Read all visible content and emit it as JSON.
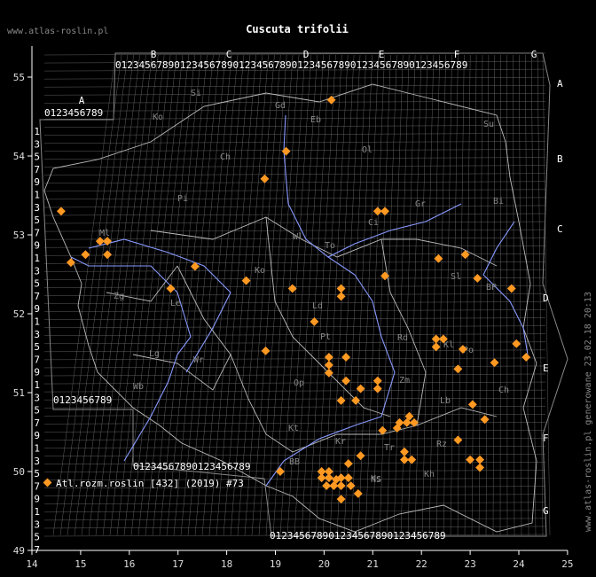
{
  "title": "Cuscuta trifolii",
  "site": "www.atlas-roslin.pl",
  "side_note": "www.atlas-roslin.pl generowane 23.02.18 20:13",
  "legend": {
    "label": "Atl.rozm.roslin [432] (2019) #73",
    "color": "#ff9922"
  },
  "colors": {
    "background": "#000000",
    "grid": "#888888",
    "river": "#8899ff",
    "border": "#bbbbbb",
    "point": "#ff9922",
    "axes": "#ffffff"
  },
  "axes": {
    "x_ticks": [
      "14",
      "15",
      "16",
      "17",
      "18",
      "19",
      "20",
      "21",
      "22",
      "23",
      "24",
      "25"
    ],
    "y_ticks": [
      "49",
      "50",
      "51",
      "52",
      "53",
      "54",
      "55"
    ]
  },
  "grid_letters_top": [
    "A",
    "B",
    "C",
    "D",
    "E",
    "F",
    "G"
  ],
  "grid_letters_right": [
    "A",
    "B",
    "C",
    "D",
    "E",
    "F",
    "G"
  ],
  "grid_digits": "0123456789",
  "region_labels": [
    "Si",
    "Gd",
    "Eb",
    "Ko",
    "Ol",
    "Ch",
    "Su",
    "Bi",
    "Pi",
    "Ci",
    "Gr",
    "Wl",
    "To",
    "Ml",
    "Ko",
    "Sl",
    "BP",
    "Zg",
    "Le",
    "Po",
    "Ld",
    "Pt",
    "Rd",
    "Lb",
    "Ch",
    "Lg",
    "Wr",
    "Op",
    "Kt",
    "Kr",
    "Ks",
    "Tr",
    "Rz",
    "Kh",
    "Zm",
    "BB",
    "NS",
    "Kl",
    "Wb"
  ],
  "points_lonlat": [
    [
      20.15,
      54.71
    ],
    [
      19.22,
      54.06
    ],
    [
      18.78,
      53.71
    ],
    [
      21.1,
      53.3
    ],
    [
      21.25,
      53.3
    ],
    [
      14.6,
      53.3
    ],
    [
      15.4,
      52.92
    ],
    [
      15.55,
      52.92
    ],
    [
      15.1,
      52.75
    ],
    [
      15.55,
      52.75
    ],
    [
      14.8,
      52.65
    ],
    [
      17.35,
      52.6
    ],
    [
      22.35,
      52.7
    ],
    [
      22.9,
      52.75
    ],
    [
      21.25,
      52.48
    ],
    [
      18.4,
      52.42
    ],
    [
      23.15,
      52.45
    ],
    [
      16.85,
      52.32
    ],
    [
      19.35,
      52.32
    ],
    [
      20.35,
      52.32
    ],
    [
      20.35,
      52.22
    ],
    [
      23.85,
      52.32
    ],
    [
      19.8,
      51.9
    ],
    [
      22.3,
      51.68
    ],
    [
      22.45,
      51.68
    ],
    [
      22.3,
      51.58
    ],
    [
      22.85,
      51.55
    ],
    [
      23.95,
      51.62
    ],
    [
      18.8,
      51.53
    ],
    [
      20.1,
      51.45
    ],
    [
      20.45,
      51.45
    ],
    [
      24.15,
      51.45
    ],
    [
      23.5,
      51.38
    ],
    [
      20.1,
      51.35
    ],
    [
      20.1,
      51.25
    ],
    [
      22.75,
      51.3
    ],
    [
      20.45,
      51.15
    ],
    [
      21.1,
      51.15
    ],
    [
      21.1,
      51.05
    ],
    [
      20.75,
      51.05
    ],
    [
      20.35,
      50.9
    ],
    [
      20.65,
      50.9
    ],
    [
      23.05,
      50.85
    ],
    [
      21.75,
      50.7
    ],
    [
      21.55,
      50.62
    ],
    [
      21.7,
      50.62
    ],
    [
      21.85,
      50.62
    ],
    [
      21.5,
      50.55
    ],
    [
      21.2,
      50.52
    ],
    [
      23.3,
      50.66
    ],
    [
      22.75,
      50.4
    ],
    [
      21.65,
      50.25
    ],
    [
      21.65,
      50.15
    ],
    [
      21.8,
      50.15
    ],
    [
      20.75,
      50.2
    ],
    [
      23.0,
      50.15
    ],
    [
      23.2,
      50.15
    ],
    [
      23.2,
      50.05
    ],
    [
      20.5,
      50.1
    ],
    [
      19.1,
      50.0
    ],
    [
      19.95,
      50.0
    ],
    [
      20.1,
      50.0
    ],
    [
      20.25,
      49.9
    ],
    [
      19.95,
      49.92
    ],
    [
      20.1,
      49.92
    ],
    [
      20.35,
      49.92
    ],
    [
      20.5,
      49.92
    ],
    [
      20.05,
      49.82
    ],
    [
      20.2,
      49.82
    ],
    [
      20.35,
      49.82
    ],
    [
      20.55,
      49.82
    ],
    [
      20.7,
      49.72
    ],
    [
      20.35,
      49.65
    ]
  ]
}
